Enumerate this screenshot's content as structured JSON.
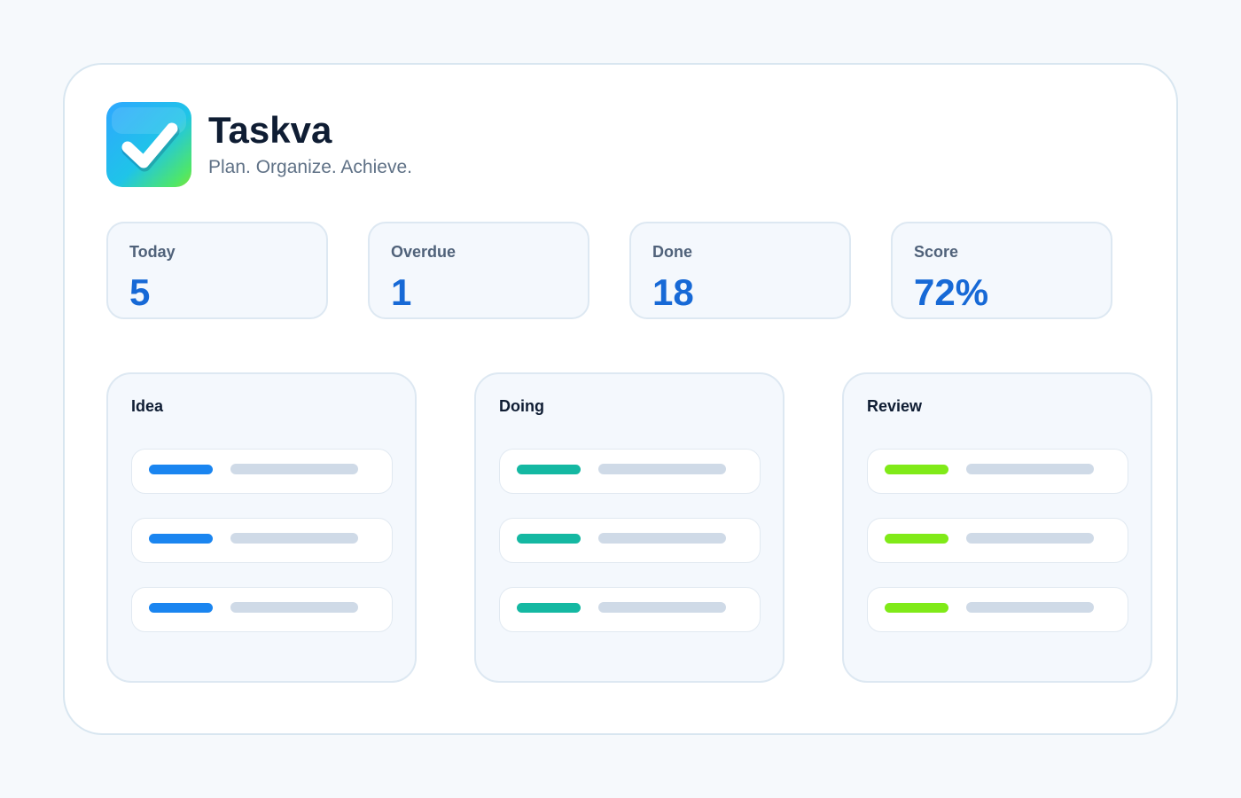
{
  "app": {
    "name": "Taskva",
    "tagline": "Plan. Organize. Achieve.",
    "logo_icon": "check-mark-icon"
  },
  "stats": [
    {
      "label": "Today",
      "value": "5"
    },
    {
      "label": "Overdue",
      "value": "1"
    },
    {
      "label": "Done",
      "value": "18"
    },
    {
      "label": "Score",
      "value": "72%"
    }
  ],
  "columns": [
    {
      "title": "Idea",
      "accent": "#1a85f0",
      "task_count": 3
    },
    {
      "title": "Doing",
      "accent": "#14b8a2",
      "task_count": 3
    },
    {
      "title": "Review",
      "accent": "#80ea18",
      "task_count": 3
    }
  ],
  "colors": {
    "page_background": "#f6f9fc",
    "title_text": "#0f1d33",
    "stat_value": "#1769d6",
    "placeholder_line": "#cfdae7"
  }
}
